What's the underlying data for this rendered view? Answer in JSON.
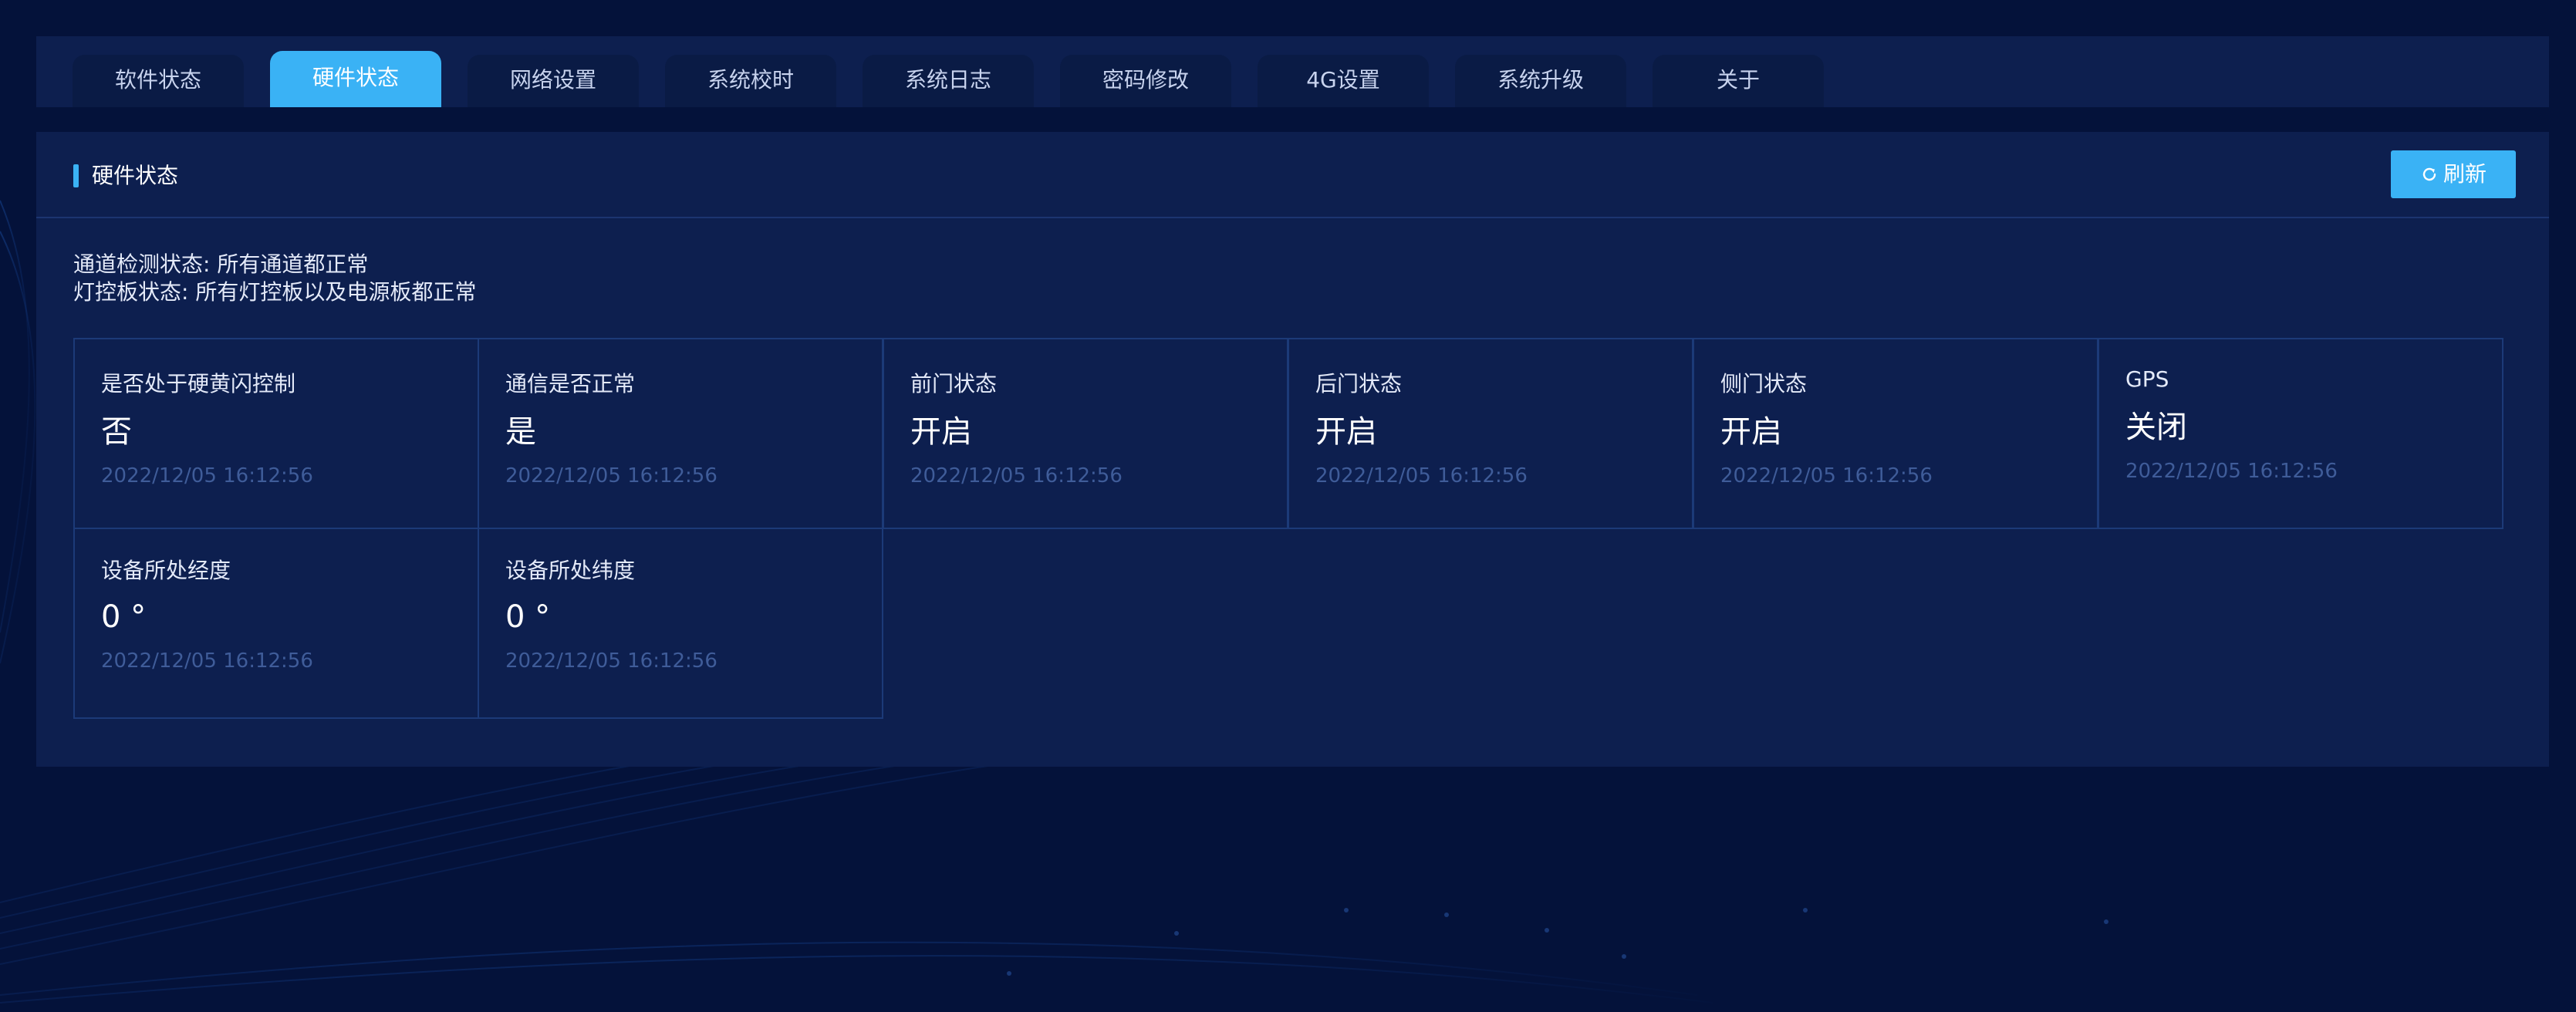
{
  "tabs": [
    {
      "label": "软件状态"
    },
    {
      "label": "硬件状态"
    },
    {
      "label": "网络设置"
    },
    {
      "label": "系统校时"
    },
    {
      "label": "系统日志"
    },
    {
      "label": "密码修改"
    },
    {
      "label": "4G设置"
    },
    {
      "label": "系统升级"
    },
    {
      "label": "关于"
    }
  ],
  "active_tab": "硬件状态",
  "panel": {
    "title": "硬件状态",
    "refresh_label": "刷新",
    "status_lines": [
      "通道检测状态: 所有通道都正常",
      "灯控板状态: 所有灯控板以及电源板都正常"
    ]
  },
  "cards": [
    {
      "label": "是否处于硬黄闪控制",
      "value": "否",
      "time": "2022/12/05 16:12:56"
    },
    {
      "label": "通信是否正常",
      "value": "是",
      "time": "2022/12/05 16:12:56"
    },
    {
      "label": "前门状态",
      "value": "开启",
      "time": "2022/12/05 16:12:56"
    },
    {
      "label": "后门状态",
      "value": "开启",
      "time": "2022/12/05 16:12:56"
    },
    {
      "label": "侧门状态",
      "value": "开启",
      "time": "2022/12/05 16:12:56"
    },
    {
      "label": "GPS",
      "value": "关闭",
      "time": "2022/12/05 16:12:56"
    },
    {
      "label": "设备所处经度",
      "value": "0 °",
      "time": "2022/12/05 16:12:56"
    },
    {
      "label": "设备所处纬度",
      "value": "0 °",
      "time": "2022/12/05 16:12:56"
    }
  ],
  "colors": {
    "accent": "#3ab2f5",
    "page_bg": "#04123a",
    "panel_bg": "#0d1f4f",
    "border": "#1c3a78",
    "timestamp": "#3f5c99"
  },
  "icons": {
    "refresh": "refresh-icon"
  }
}
